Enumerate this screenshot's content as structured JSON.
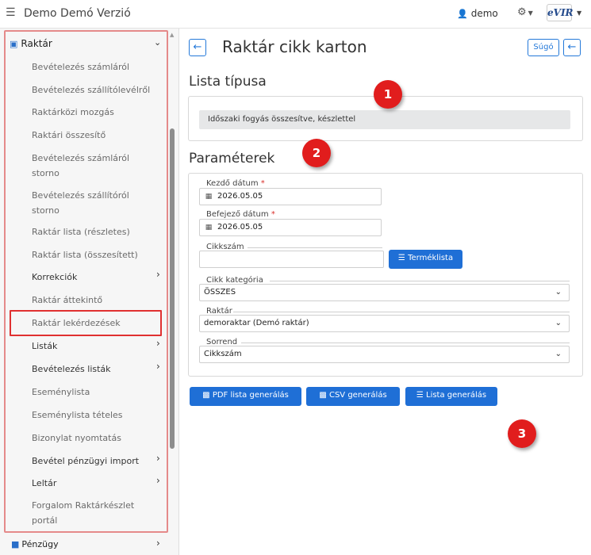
{
  "header": {
    "app_title": "Demo Demó Verzió",
    "user": "demo",
    "logo_text": "eVIR"
  },
  "sidebar": {
    "section_label": "Raktár",
    "items": [
      {
        "label": "Bevételezés számláról"
      },
      {
        "label": "Bevételezés szállítólevélről"
      },
      {
        "label": "Raktárközi mozgás"
      },
      {
        "label": "Raktári összesítő"
      },
      {
        "label": "Bevételezés számláról storno"
      },
      {
        "label": "Bevételezés szállítóról storno"
      },
      {
        "label": "Raktár lista (részletes)"
      },
      {
        "label": "Raktár lista (összesített)"
      },
      {
        "label": "Korrekciók"
      },
      {
        "label": "Raktár áttekintő"
      },
      {
        "label": "Raktár lekérdezések"
      },
      {
        "label": "Listák"
      },
      {
        "label": "Bevételezés listák"
      },
      {
        "label": "Eseménylista"
      },
      {
        "label": "Eseménylista tételes"
      },
      {
        "label": "Bizonylat nyomtatás"
      },
      {
        "label": "Bevétel pénzügyi import"
      },
      {
        "label": "Leltár"
      },
      {
        "label": "Forgalom Raktárkészlet portál"
      }
    ],
    "next_section_label": "Pénzügy"
  },
  "main": {
    "title": "Raktár cikk karton",
    "help_label": "Súgó",
    "list_type_heading": "Lista típusa",
    "list_type_value": "Időszaki fogyás összesítve, készlettel",
    "params_heading": "Paraméterek",
    "start_date_label": "Kezdő dátum",
    "start_date_value": "2026.05.05",
    "end_date_label": "Befejező dátum",
    "end_date_value": "2026.05.05",
    "required_mark": "*",
    "sku_label": "Cikkszám",
    "product_list_button": "Terméklista",
    "category_label": "Cikk kategória",
    "category_value": "ÖSSZES",
    "warehouse_label": "Raktár",
    "warehouse_value": "demoraktar (Demó raktár)",
    "order_label": "Sorrend",
    "order_value": "Cikkszám",
    "pdf_button": "PDF lista generálás",
    "csv_button": "CSV generálás",
    "list_button": "Lista generálás"
  },
  "markers": [
    "1",
    "2",
    "3"
  ],
  "colors": {
    "accent": "#1f6fd6",
    "highlight": "#e03030",
    "marker": "#e11d1d"
  }
}
